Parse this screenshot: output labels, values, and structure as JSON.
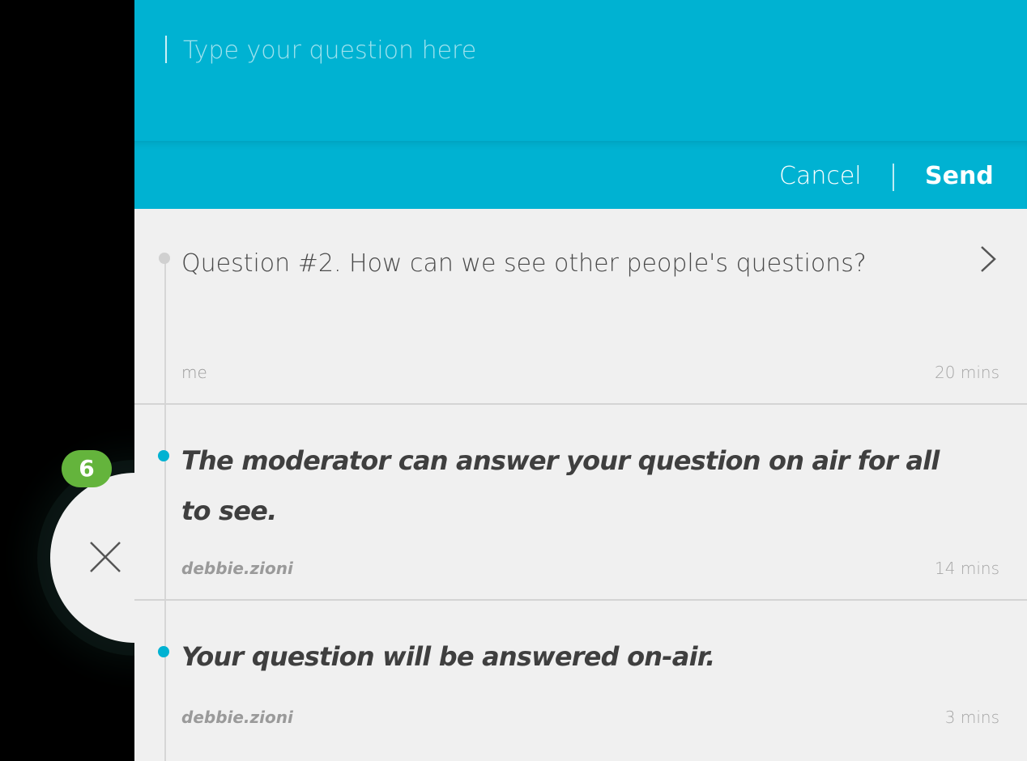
{
  "compose": {
    "placeholder": "Type your question here",
    "value": "",
    "cancel_label": "Cancel",
    "send_label": "Send"
  },
  "questions": [
    {
      "text": "Question #2.  How can we see other people's questions?",
      "author": "me",
      "time": "20 mins",
      "kind": "question"
    },
    {
      "text": "The moderator can answer your question on air for all to see.",
      "author": "debbie.zioni",
      "time": "14 mins",
      "kind": "answer"
    },
    {
      "text": "Your question will be answered on-air.",
      "author": "debbie.zioni",
      "time": "3 mins",
      "kind": "answer"
    }
  ],
  "badge": {
    "count": "6"
  },
  "icons": {
    "close": "close-icon",
    "chevron": "chevron-right-icon"
  },
  "colors": {
    "accent": "#00b2d2",
    "badge": "#64b43c",
    "panel": "#f0f0f0"
  }
}
